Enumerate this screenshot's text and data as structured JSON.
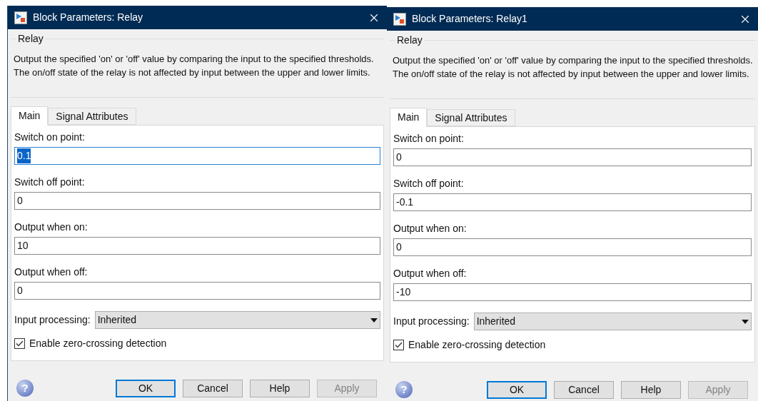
{
  "dialogs": [
    {
      "title": "Block Parameters: Relay",
      "group_title": "Relay",
      "description": "Output the specified 'on' or 'off' value by comparing the input to the specified thresholds.  The on/off state of the relay is not affected by input between the upper and lower limits.",
      "tabs": [
        {
          "label": "Main",
          "selected": true
        },
        {
          "label": "Signal Attributes",
          "selected": false
        }
      ],
      "fields": [
        {
          "label": "Switch on point:",
          "value": "0.1",
          "focused": true
        },
        {
          "label": "Switch off point:",
          "value": "0",
          "focused": false
        },
        {
          "label": "Output when on:",
          "value": "10",
          "focused": false
        },
        {
          "label": "Output when off:",
          "value": "0",
          "focused": false
        }
      ],
      "input_processing": {
        "label": "Input processing:",
        "value": "Inherited"
      },
      "checkbox": {
        "label": "Enable zero-crossing detection",
        "checked": true
      },
      "help_symbol": "?",
      "buttons": [
        {
          "label": "OK",
          "default": true,
          "disabled": false
        },
        {
          "label": "Cancel",
          "default": false,
          "disabled": false
        },
        {
          "label": "Help",
          "default": false,
          "disabled": false
        },
        {
          "label": "Apply",
          "default": false,
          "disabled": true
        }
      ]
    },
    {
      "title": "Block Parameters: Relay1",
      "group_title": "Relay",
      "description": "Output the specified 'on' or 'off' value by comparing the input to the specified thresholds.  The on/off state of the relay is not affected by input between the upper and lower limits.",
      "tabs": [
        {
          "label": "Main",
          "selected": true
        },
        {
          "label": "Signal Attributes",
          "selected": false
        }
      ],
      "fields": [
        {
          "label": "Switch on point:",
          "value": "0",
          "focused": false
        },
        {
          "label": "Switch off point:",
          "value": "-0.1",
          "focused": false
        },
        {
          "label": "Output when on:",
          "value": "0",
          "focused": false
        },
        {
          "label": "Output when off:",
          "value": "-10",
          "focused": false
        }
      ],
      "input_processing": {
        "label": "Input processing:",
        "value": "Inherited"
      },
      "checkbox": {
        "label": "Enable zero-crossing detection",
        "checked": true
      },
      "help_symbol": "?",
      "buttons": [
        {
          "label": "OK",
          "default": true,
          "disabled": false
        },
        {
          "label": "Cancel",
          "default": false,
          "disabled": false
        },
        {
          "label": "Help",
          "default": false,
          "disabled": false
        },
        {
          "label": "Apply",
          "default": false,
          "disabled": true
        }
      ]
    }
  ]
}
